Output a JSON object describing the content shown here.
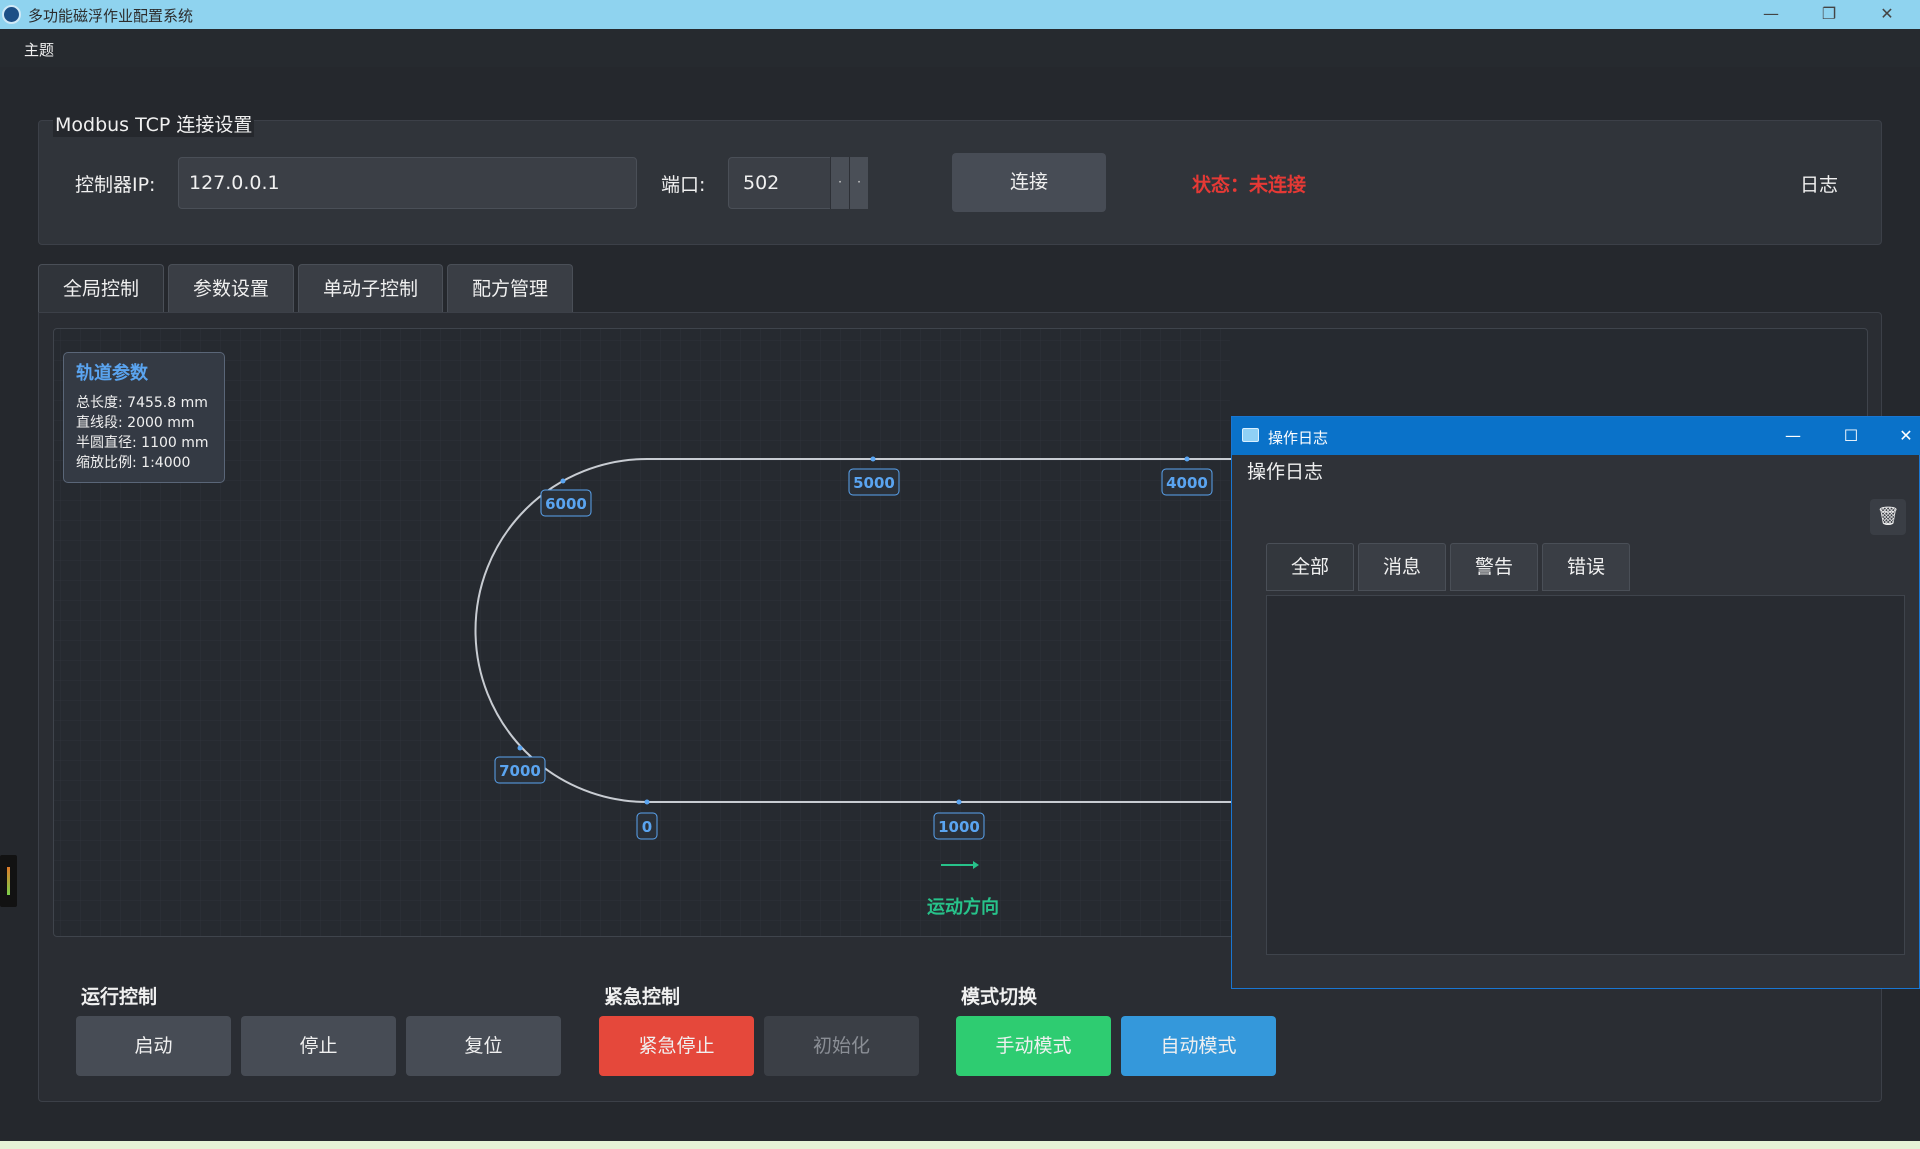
{
  "window": {
    "title": "多功能磁浮作业配置系统",
    "minimize": "—",
    "restore": "❐",
    "close": "✕"
  },
  "menu": {
    "theme": "主题"
  },
  "connection": {
    "group_title": "Modbus TCP 连接设置",
    "ip_label": "控制器IP:",
    "ip_value": "127.0.0.1",
    "port_label": "端口:",
    "port_value": "502",
    "spin_up": "·",
    "spin_down": "·",
    "connect_label": "连接",
    "status_text": "状态：未连接",
    "status_color": "#e53935",
    "log_label": "日志"
  },
  "tabs": [
    {
      "label": "全局控制"
    },
    {
      "label": "参数设置"
    },
    {
      "label": "单动子控制"
    },
    {
      "label": "配方管理"
    }
  ],
  "track": {
    "info_title": "轨道参数",
    "total_length": "总长度: 7455.8 mm",
    "straight": "直线段: 2000 mm",
    "diameter": "半圆直径: 1100 mm",
    "scale": "缩放比例: 1:4000",
    "markers": [
      "6000",
      "5000",
      "4000",
      "7000",
      "0",
      "1000"
    ],
    "direction_label": "运动方向"
  },
  "controls": {
    "run_title": "运行控制",
    "start": "启动",
    "stop": "停止",
    "reset": "复位",
    "emergency_title": "紧急控制",
    "estop": "紧急停止",
    "init": "初始化",
    "mode_title": "模式切换",
    "manual": "手动模式",
    "auto": "自动模式"
  },
  "log_window": {
    "title": "操作日志",
    "heading": "操作日志",
    "minimize": "—",
    "maximize": "☐",
    "close": "✕",
    "clear_icon": "🗑",
    "filters": [
      {
        "label": "全部"
      },
      {
        "label": "消息"
      },
      {
        "label": "警告"
      },
      {
        "label": "错误"
      }
    ]
  },
  "colors": {
    "accent_blue": "#5aa4f0",
    "direction_green": "#27c28a",
    "estop_red": "#e5483b",
    "manual_green": "#2ecc71",
    "auto_blue": "#3498db"
  }
}
